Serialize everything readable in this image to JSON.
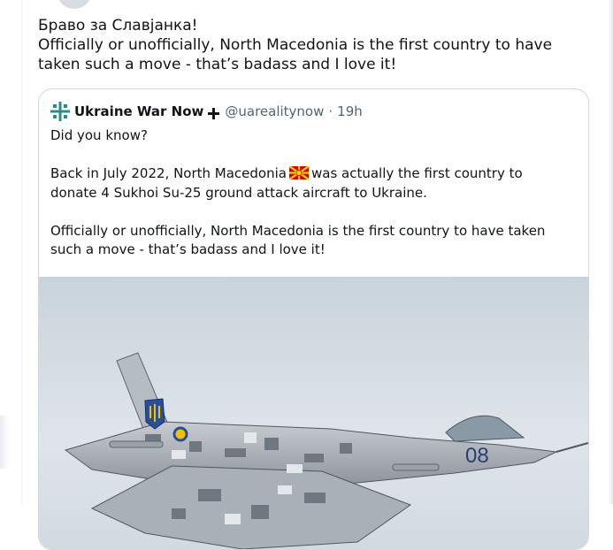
{
  "reply": {
    "lines": [
      "Браво за Славјанка!",
      "Officially or unofficially, North Macedonia is the first country to have",
      "taken such a move - that’s badass and I love it!"
    ]
  },
  "quote": {
    "author": "Ukraine War Now",
    "handle": "@uarealitynow",
    "separator": "·",
    "time": "19h",
    "line1": "Did you know?",
    "line2a": "Back in July 2022, North Macedonia",
    "line2b": "was actually the first country to",
    "line3": "donate 4 Sukhoi Su-25 ground attack aircraft to Ukraine.",
    "line4": "Officially or unofficially, North Macedonia is the first country to have taken",
    "line5": "such a move - that’s badass and I love it!",
    "media_label": "08",
    "flag_icon": "north-macedonia-flag-emoji",
    "brand_icon": "ukraine-war-now-logo",
    "badge_icon": "cross-icon"
  },
  "colors": {
    "text": "#0f1419",
    "muted": "#536471",
    "border": "#cfd9de",
    "brand_teal": "#2b8c8a",
    "sky": "#d7dee4"
  }
}
